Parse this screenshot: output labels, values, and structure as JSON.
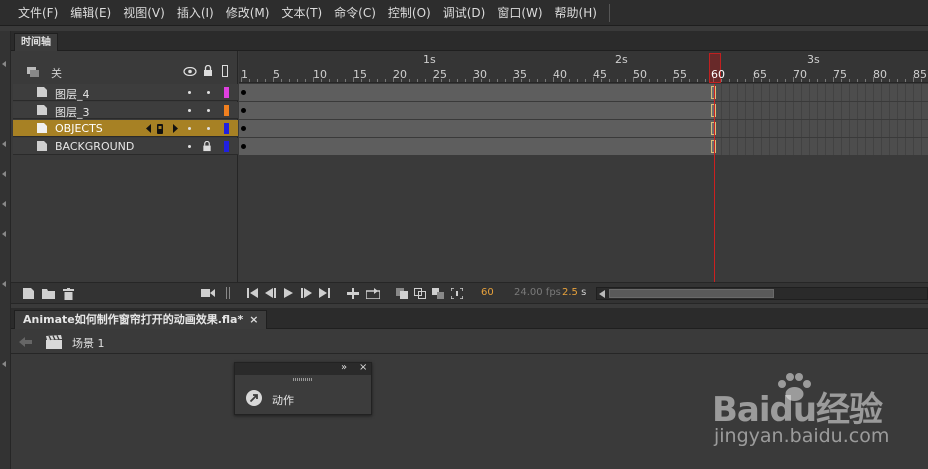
{
  "menu": {
    "items": [
      "文件(F)",
      "编辑(E)",
      "视图(V)",
      "插入(I)",
      "修改(M)",
      "文本(T)",
      "命令(C)",
      "控制(O)",
      "调试(D)",
      "窗口(W)",
      "帮助(H)"
    ]
  },
  "timeline": {
    "tab_label": "时间轴",
    "header_label": "关",
    "layers": [
      {
        "name": "图层_4",
        "color": "#e040e0"
      },
      {
        "name": "图层_3",
        "color": "#f08020"
      },
      {
        "name": "OBJECTS",
        "color": "#2020e0"
      },
      {
        "name": "BACKGROUND",
        "color": "#2020e0"
      }
    ],
    "seconds": [
      "1s",
      "2s",
      "3s"
    ],
    "frame_numbers": [
      "1",
      "5",
      "10",
      "15",
      "20",
      "25",
      "30",
      "35",
      "40",
      "45",
      "50",
      "55",
      "60",
      "65",
      "70",
      "75",
      "80",
      "85"
    ],
    "current_frame": "60",
    "fps": "24.00 fps",
    "time": "2.5",
    "time_unit": "s"
  },
  "document": {
    "tab_label": "Animate如何制作窗帘打开的动画效果.fla*",
    "close_glyph": "×",
    "scene_label": "场景 1"
  },
  "actions_panel": {
    "item_label": "动作",
    "expand_glyph": "»",
    "close_glyph": "×"
  },
  "watermark": {
    "brand": "Baidu经验",
    "url": "jingyan.baidu.com"
  }
}
